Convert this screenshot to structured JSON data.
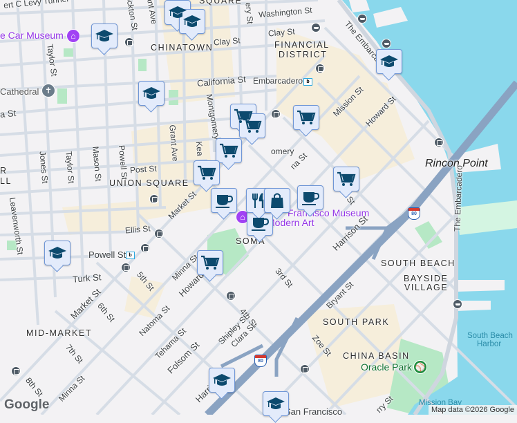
{
  "map": {
    "colors": {
      "land": "#f3f2f4",
      "water": "#8ad8ec",
      "park": "#b6e8c5",
      "commercial": "#f6eedb",
      "road": "#d6dde6",
      "freeway": "#8aa3c2",
      "marker_bg": "#e3ebfb",
      "marker_icon": "#0c4a6e",
      "poi": "#9334e6"
    },
    "neighborhoods": {
      "chinatown": "CHINATOWN",
      "financial1": "FINANCIAL",
      "financial2": "DISTRICT",
      "union_square": "UNION SQUARE",
      "soma": "SOMA",
      "mid_market": "MID-MARKET",
      "south_beach": "SOUTH BEACH",
      "bayside1": "BAYSIDE",
      "bayside2": "VILLAGE",
      "south_park": "SOUTH PARK",
      "china_basin": "CHINA BASIN",
      "square_top": "SQUARE",
      "tenderloin_r": "R",
      "tenderloin_ll": "LL"
    },
    "places": {
      "rincon_point": "Rincon Point",
      "south_beach_harbor1": "South Beach",
      "south_beach_harbor2": "Harbor",
      "mission_bay": "Mission Bay",
      "cable_car_museum": "e Car Museum",
      "cathedral": "Cathedral",
      "sfmoma1": "Francisco Museum",
      "sfmoma2": "Modern Art",
      "oracle_park": "Oracle Park",
      "embarcadero_station": "Embarcadero",
      "powell_station": "Powell St",
      "sf_bottom": "San Francisco"
    },
    "streets": {
      "levy": "ert C Levy Tunnel",
      "stockton": "ockton St",
      "grant_top": "ant Ave",
      "washington": "Washington St",
      "clay_w": "Clay St",
      "clay_e": "Clay St",
      "battery": "ery St",
      "taylor_n": "Taylor St",
      "california": "California St",
      "montgomery": "Montgomery",
      "mission": "Mission St",
      "howard_e": "Howard St",
      "embarcadero_n": "The Embarcadero",
      "embarcadero_e": "The Embarcadero",
      "sacramento": "a St",
      "jones": "Jones St",
      "taylor": "Taylor St",
      "mason": "Mason St",
      "powell": "Powell St",
      "grant": "Grant Ave",
      "post": "Post St",
      "kearny": "Kea",
      "market_n": "Market St",
      "leavenworth": "Leavenworth St",
      "ellis": "Ellis St",
      "turk": "Turk St",
      "fifth": "5th St",
      "minna_n": "Minna St",
      "howard_s": "Howard St",
      "market_s": "Market St",
      "sixth": "6th St",
      "natoma": "Natoma St",
      "tehama": "Tehama St",
      "fourth": "4th St",
      "shipley": "Shipley St",
      "clara": "Clara St",
      "folsom": "Folsom St",
      "seventh": "7th St",
      "eighth": "8th St",
      "minna_s": "Minna St",
      "harrison_s": "Harris",
      "harrison_e": "Harrison St",
      "third": "3rd St",
      "bryant": "Bryant St",
      "zoe": "Zoe St",
      "berry": "rry St",
      "montgomery_e": "omery",
      "natoma_e": "na St",
      "second": "St"
    },
    "shields": {
      "i80_a": "80",
      "i80_b": "80"
    },
    "markers": [
      {
        "type": "school"
      },
      {
        "type": "school"
      },
      {
        "type": "school"
      },
      {
        "type": "school"
      },
      {
        "type": "school"
      },
      {
        "type": "school"
      },
      {
        "type": "school"
      },
      {
        "type": "school"
      },
      {
        "type": "grocery"
      },
      {
        "type": "grocery"
      },
      {
        "type": "grocery"
      },
      {
        "type": "grocery"
      },
      {
        "type": "grocery"
      },
      {
        "type": "grocery"
      },
      {
        "type": "grocery"
      },
      {
        "type": "cafe"
      },
      {
        "type": "cafe"
      },
      {
        "type": "cafe"
      },
      {
        "type": "restaurant"
      },
      {
        "type": "shopping"
      }
    ],
    "logo": "Google",
    "attribution": "Map data ©2026 Google"
  }
}
